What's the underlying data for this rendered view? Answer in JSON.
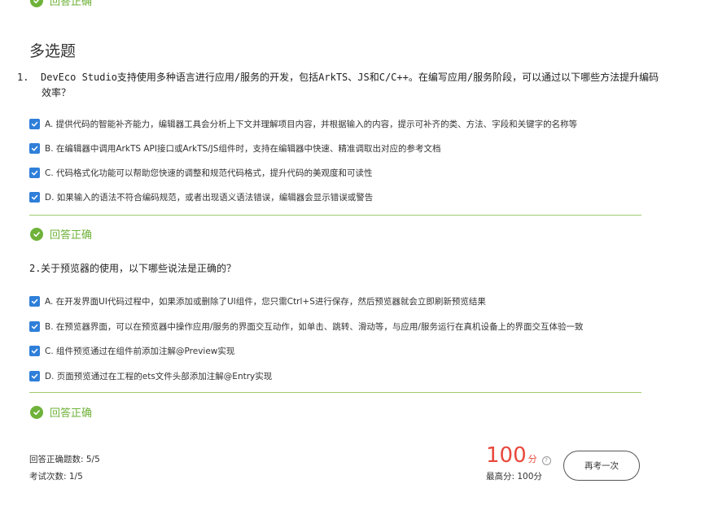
{
  "top_verdict": {
    "label": "回答正确"
  },
  "section": {
    "title": "多选题"
  },
  "questions": [
    {
      "number": "1.",
      "text": "DevEco Studio支持使用多种语言进行应用/服务的开发，包括ArkTS、JS和C/C++。在编写应用/服务阶段，可以通过以下哪些方法提升编码效率？",
      "options": [
        {
          "text": "A. 提供代码的智能补齐能力，编辑器工具会分析上下文并理解项目内容，并根据输入的内容，提示可补齐的类、方法、字段和关键字的名称等",
          "checked": true
        },
        {
          "text": "B. 在编辑器中调用ArkTS API接口或ArkTS/JS组件时，支持在编辑器中快速、精准调取出对应的参考文档",
          "checked": true
        },
        {
          "text": "C. 代码格式化功能可以帮助您快速的调整和规范代码格式，提升代码的美观度和可读性",
          "checked": true
        },
        {
          "text": "D. 如果输入的语法不符合编码规范，或者出现语义语法错误，编辑器会显示错误或警告",
          "checked": true
        }
      ],
      "verdict": "回答正确"
    },
    {
      "number": "2.",
      "text": "关于预览器的使用，以下哪些说法是正确的？",
      "options": [
        {
          "text": "A. 在开发界面UI代码过程中，如果添加或删除了UI组件，您只需Ctrl+S进行保存，然后预览器就会立即刷新预览结果",
          "checked": true
        },
        {
          "text": "B. 在预览器界面，可以在预览器中操作应用/服务的界面交互动作，如单击、跳转、滑动等，与应用/服务运行在真机设备上的界面交互体验一致",
          "checked": true
        },
        {
          "text": "C. 组件预览通过在组件前添加注解@Preview实现",
          "checked": true
        },
        {
          "text": "D. 页面预览通过在工程的ets文件头部添加注解@Entry实现",
          "checked": true
        }
      ],
      "verdict": "回答正确"
    }
  ],
  "summary": {
    "correct_count": "回答正确题数: 5/5",
    "attempts": "考试次数: 1/5",
    "score": "100",
    "score_unit": "分",
    "best_score": "最高分:  100分",
    "retry_label": "再考一次"
  },
  "colors": {
    "accent_green": "#6fb23a",
    "checkbox_blue": "#2f7fd9",
    "score_red": "#e8493c"
  }
}
